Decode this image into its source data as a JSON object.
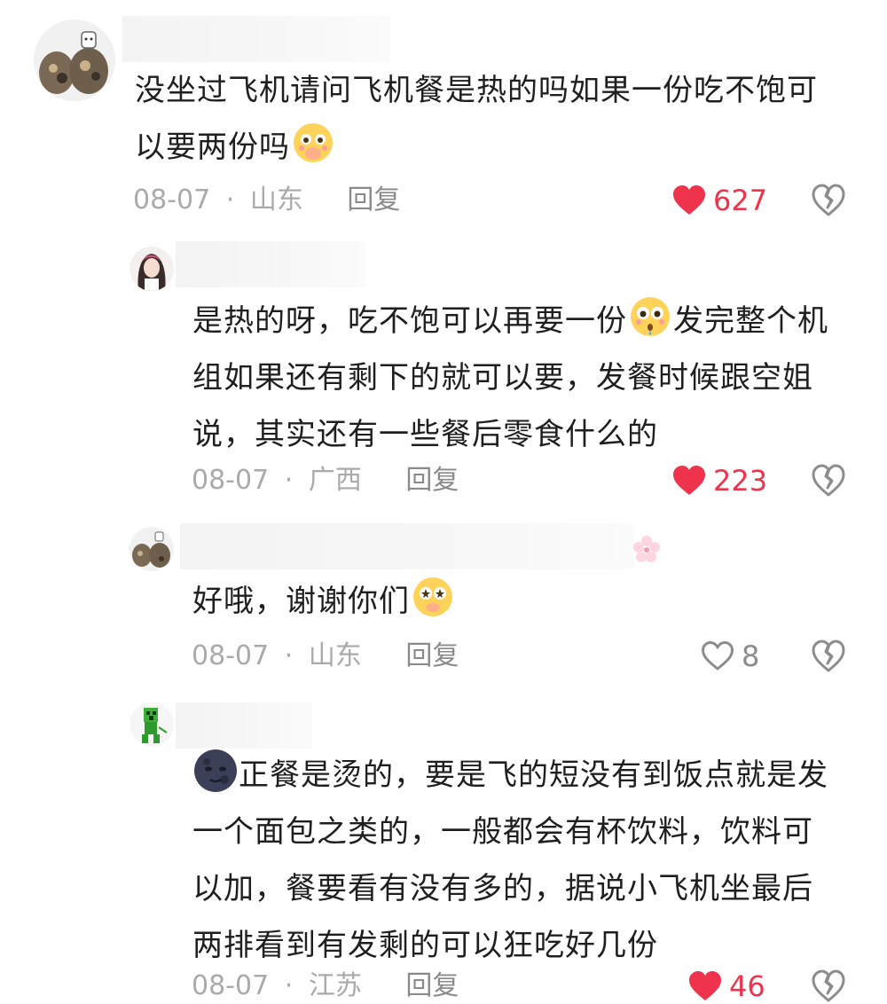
{
  "comments": [
    {
      "text_lines": [
        "没坐过飞机请问飞机餐是热的吗如果一份吃不饱可",
        "以要两份吗"
      ],
      "date": "08-07",
      "location": "山东",
      "reply_label": "回复",
      "likes": "627",
      "liked": true,
      "avatar_icon": "cat-collage-avatar"
    },
    {
      "text_lines": [
        "是热的呀，吃不饱可以再要一份",
        "发完整个机",
        "组如果还有剩下的就可以要，发餐时候跟空姐",
        "说，其实还有一些餐后零食什么的"
      ],
      "date": "08-07",
      "location": "广西",
      "reply_label": "回复",
      "likes": "223",
      "liked": true,
      "avatar_icon": "anime-girl-avatar"
    },
    {
      "text_lines": [
        "好哦，谢谢你们"
      ],
      "date": "08-07",
      "location": "山东",
      "reply_label": "回复",
      "likes": "8",
      "liked": false,
      "avatar_icon": "cat-collage-avatar"
    },
    {
      "text_lines": [
        "正餐是烫的，要是飞的短没有到饭点就是发",
        "一个面包之类的，一般都会有杯饮料，饮料可",
        "以加，餐要看有没有多的，据说小飞机坐最后",
        "两排看到有发剩的可以狂吃好几份"
      ],
      "date": "08-07",
      "location": "江苏",
      "reply_label": "回复",
      "likes": "46",
      "liked": true,
      "avatar_icon": "green-creeper-avatar"
    }
  ],
  "separator": "·",
  "colors": {
    "like_red": "#f0334d",
    "meta_grey": "#aaaaaa",
    "text": "#1f1f1f"
  }
}
